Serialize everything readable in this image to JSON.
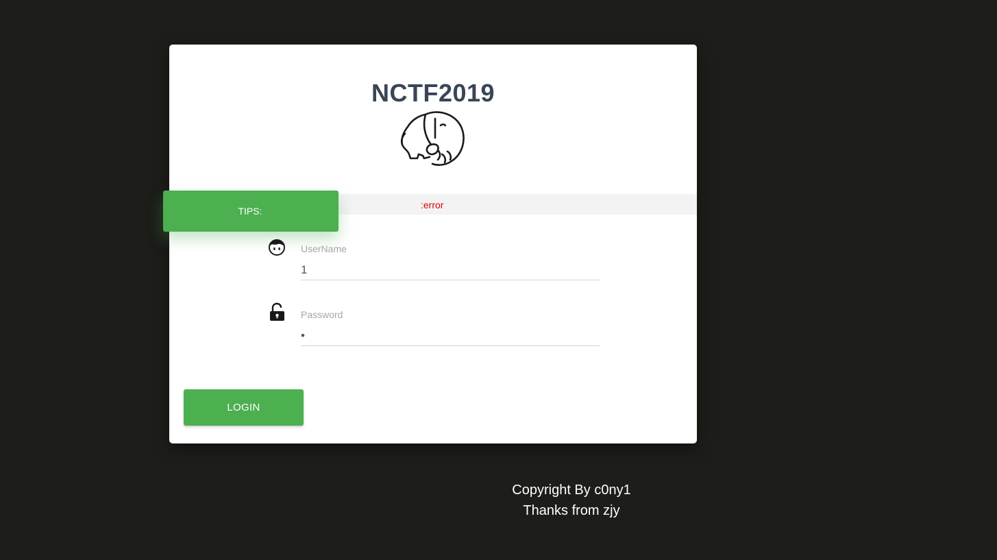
{
  "title": "NCTF2019",
  "logo": {
    "icon": "elephant-icon"
  },
  "tips": {
    "label": "TIPS:",
    "message": ":error",
    "label_color": "#4caf50",
    "message_color": "#e00000"
  },
  "form": {
    "username": {
      "label": "UserName",
      "value": "1",
      "icon": "user-face-icon"
    },
    "password": {
      "label": "Password",
      "value": "•",
      "icon": "unlock-icon"
    },
    "login_label": "LOGIN"
  },
  "footer": {
    "line1": "Copyright By c0ny1",
    "line2": "Thanks from zjy"
  },
  "colors": {
    "background": "#1d1d1a",
    "accent": "#4caf50",
    "title": "#3a4556"
  }
}
